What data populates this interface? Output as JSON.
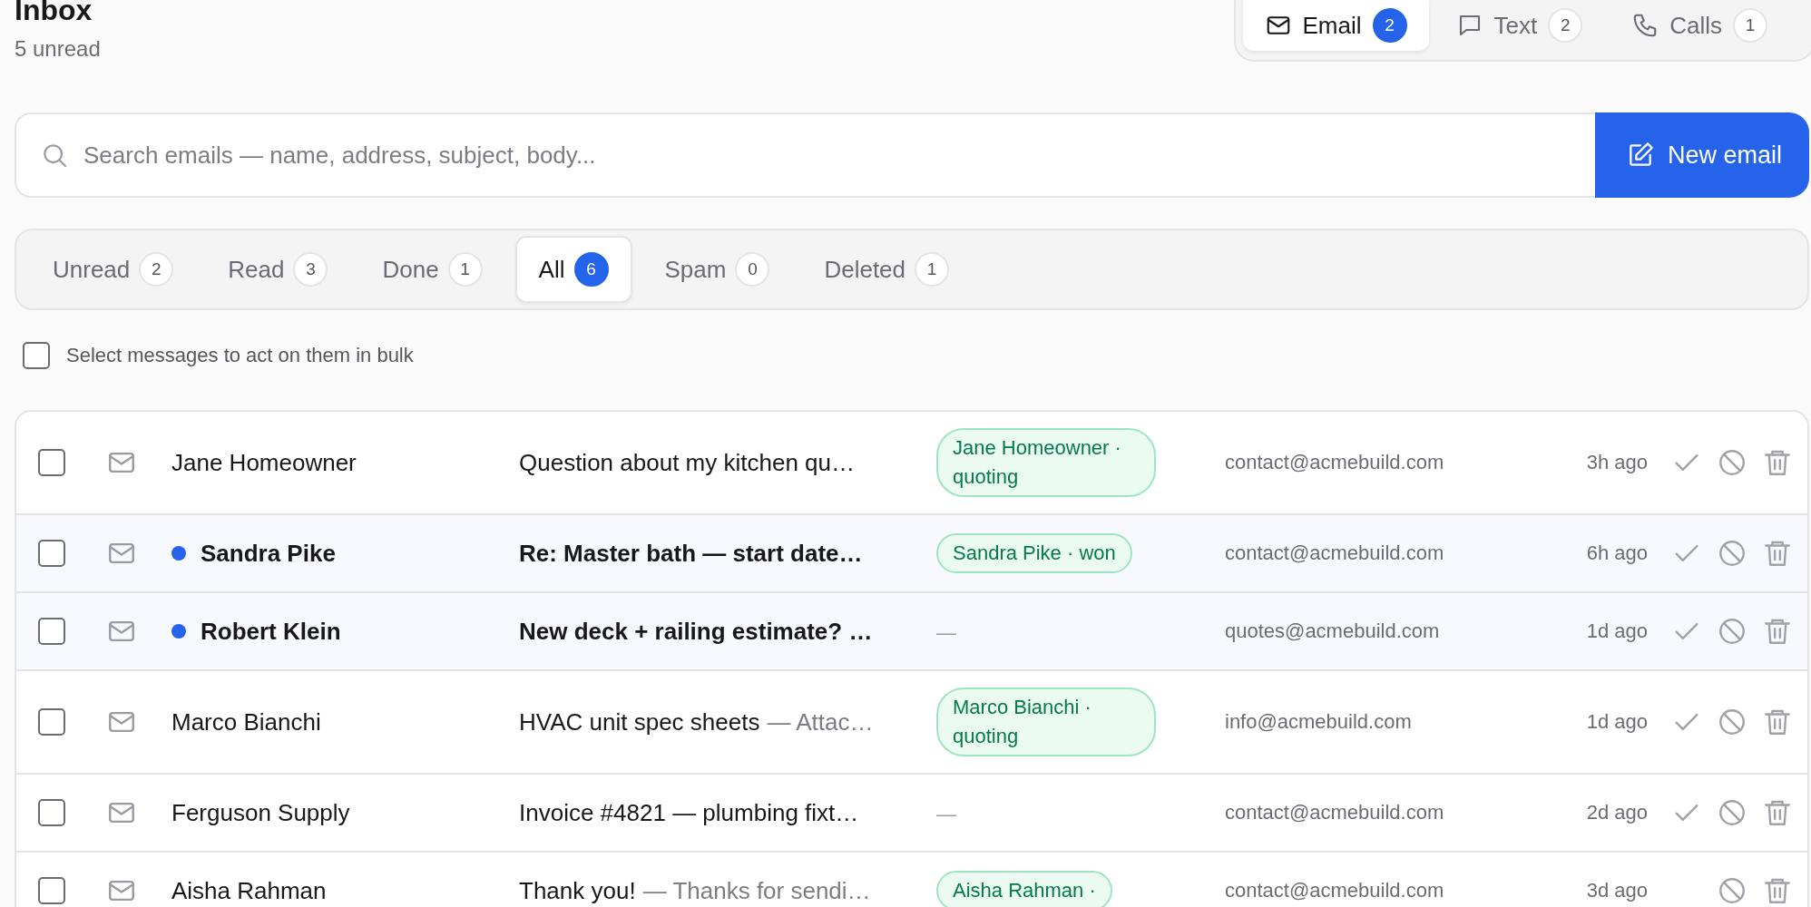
{
  "header": {
    "title": "Inbox",
    "subtitle": "5 unread"
  },
  "channel_tabs": [
    {
      "kind": "email",
      "label": "Email",
      "count": "2",
      "selected": true
    },
    {
      "kind": "text",
      "label": "Text",
      "count": "2",
      "selected": false
    },
    {
      "kind": "calls",
      "label": "Calls",
      "count": "1",
      "selected": false
    }
  ],
  "search": {
    "placeholder": "Search emails — name, address, subject, body..."
  },
  "new_button": {
    "label": "New email"
  },
  "filter_tabs": [
    {
      "label": "Unread",
      "count": "2",
      "selected": false
    },
    {
      "label": "Read",
      "count": "3",
      "selected": false
    },
    {
      "label": "Done",
      "count": "1",
      "selected": false
    },
    {
      "label": "All",
      "count": "6",
      "selected": true
    },
    {
      "label": "Spam",
      "count": "0",
      "selected": false
    },
    {
      "label": "Deleted",
      "count": "1",
      "selected": false
    }
  ],
  "bulk": {
    "label": "Select messages to act on them in bulk",
    "checked": false
  },
  "messages": [
    {
      "sender": "Jane Homeowner",
      "subject": "Question about my kitchen qu…",
      "tag": "Jane Homeowner · quoting",
      "address": "contact@acmebuild.com",
      "time": "3h ago",
      "unread": false,
      "checked": false,
      "done_icon": true
    },
    {
      "sender": "Sandra Pike",
      "subject": "Re: Master bath — start date…",
      "tag": "Sandra Pike · won",
      "address": "contact@acmebuild.com",
      "time": "6h ago",
      "unread": true,
      "checked": false,
      "done_icon": true
    },
    {
      "sender": "Robert Klein",
      "subject": "New deck + railing estimate? …",
      "tag": "—",
      "address": "quotes@acmebuild.com",
      "time": "1d ago",
      "unread": true,
      "checked": false,
      "done_icon": true
    },
    {
      "sender": "Marco Bianchi",
      "subject": "HVAC unit spec sheets",
      "preview": "— Attac…",
      "tag": "Marco Bianchi · quoting",
      "address": "info@acmebuild.com",
      "time": "1d ago",
      "unread": false,
      "checked": false,
      "done_icon": true
    },
    {
      "sender": "Ferguson Supply",
      "subject": "Invoice #4821 — plumbing fixt…",
      "tag": "—",
      "address": "contact@acmebuild.com",
      "time": "2d ago",
      "unread": false,
      "checked": false,
      "done_icon": true
    },
    {
      "sender": "Aisha Rahman",
      "subject": "Thank you!",
      "preview": "— Thanks for sendi…",
      "tag": "Aisha Rahman ·",
      "address": "contact@acmebuild.com",
      "time": "3d ago",
      "unread": false,
      "checked": false,
      "done_icon": false
    }
  ]
}
